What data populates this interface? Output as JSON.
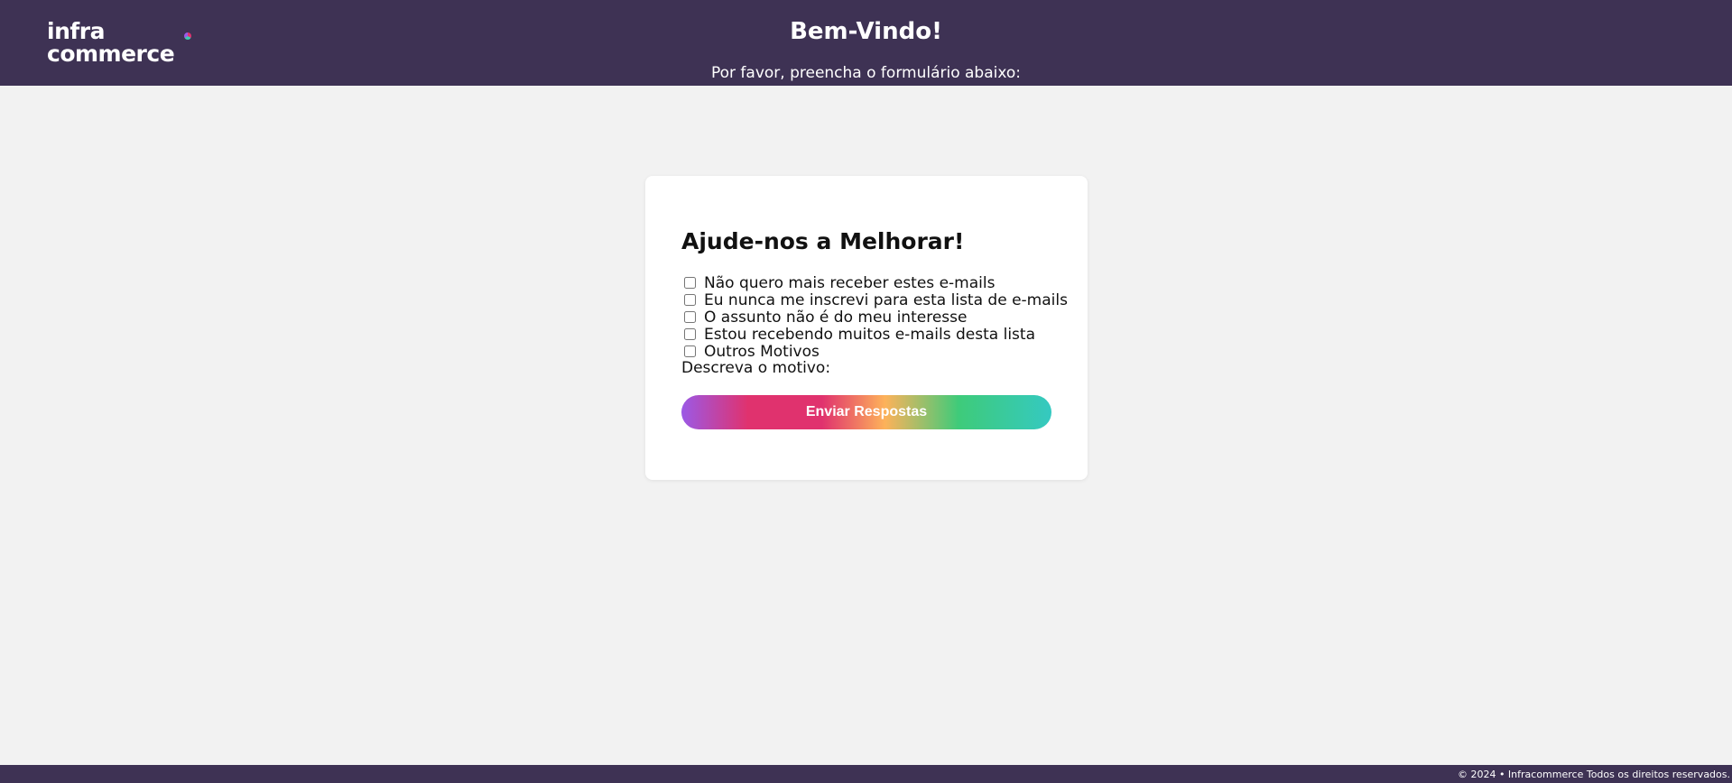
{
  "header": {
    "logo": {
      "line1": "infra",
      "line2": "commerce"
    },
    "title": "Bem-Vindo!",
    "subtitle": "Por favor, preencha o formulário abaixo:"
  },
  "form": {
    "title": "Ajude-nos a Melhorar!",
    "options": [
      {
        "label": "Não quero mais receber estes e-mails",
        "checked": false
      },
      {
        "label": "Eu nunca me inscrevi para esta lista de e-mails",
        "checked": false
      },
      {
        "label": "O assunto não é do meu interesse",
        "checked": false
      },
      {
        "label": "Estou recebendo muitos e-mails desta lista",
        "checked": false
      },
      {
        "label": "Outros Motivos",
        "checked": false
      }
    ],
    "describe_label": "Descreva o motivo:",
    "submit_label": "Enviar Respostas"
  },
  "footer": {
    "text": "© 2024 • Infracommerce Todos os direitos reservados."
  },
  "colors": {
    "header_bg": "#3e3254",
    "page_bg": "#f2f2f2",
    "card_bg": "#ffffff",
    "button_gradient": [
      "#9b59e6",
      "#e0326e",
      "#fdb25a",
      "#3ecb7a",
      "#35c9c1"
    ]
  }
}
